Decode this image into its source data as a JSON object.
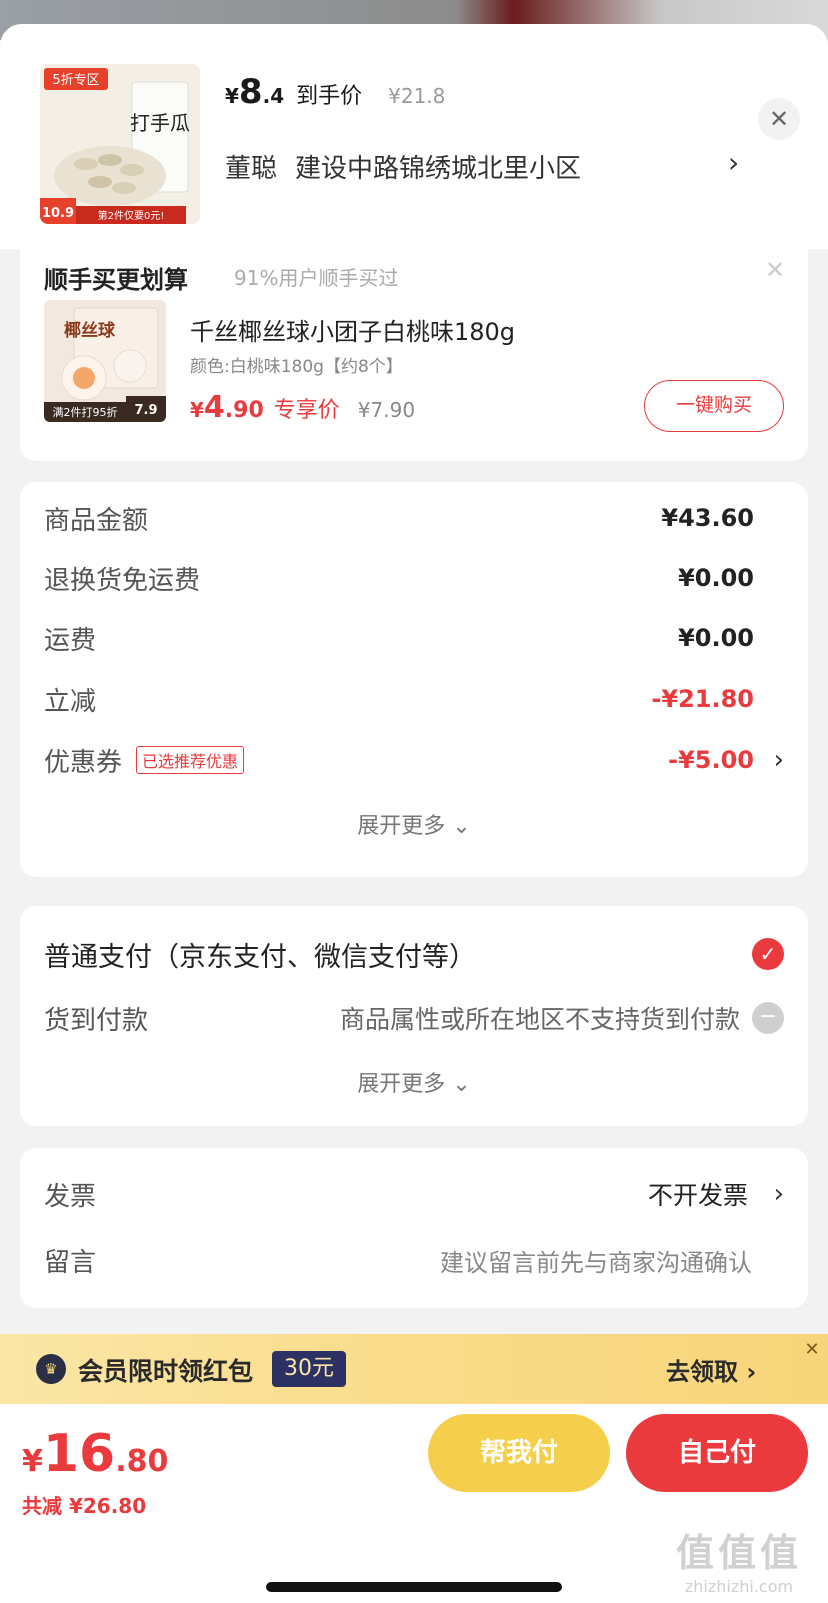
{
  "header": {
    "price_currency": "¥",
    "price_integer": "8",
    "price_decimal": ".4",
    "price_label": "到手价",
    "original_price": "¥21.8",
    "recipient": "董聪",
    "address": "建设中路锦绣城北里小区",
    "thumb_badge": "5折专区",
    "thumb_title": "打手瓜",
    "thumb_price": "10.9",
    "thumb_note": "第2件仅要0元!"
  },
  "recommendation": {
    "title": "顺手买更划算",
    "subtitle": "91%用户顺手买过",
    "product_name": "千丝椰丝球小团子白桃味180g",
    "variant": "颜色:白桃味180g【约8个】",
    "price_currency": "¥",
    "price_integer": "4",
    "price_decimal": ".90",
    "price_label": "专享价",
    "original_price": "¥7.90",
    "buy_label": "一键购买",
    "thumb_title": "椰丝球",
    "thumb_promo": "满2件打95折",
    "thumb_price": "7.9"
  },
  "amounts": {
    "rows": [
      {
        "label": "商品金额",
        "value": "¥43.60"
      },
      {
        "label": "退换货免运费",
        "value": "¥0.00"
      },
      {
        "label": "运费",
        "value": "¥0.00"
      },
      {
        "label": "立减",
        "value": "-¥21.80"
      },
      {
        "label": "优惠券",
        "value": "-¥5.00",
        "tag": "已选推荐优惠"
      }
    ],
    "expand_label": "展开更多"
  },
  "payment": {
    "option1": "普通支付（京东支付、微信支付等）",
    "option2": "货到付款",
    "option2_note": "商品属性或所在地区不支持货到付款",
    "expand_label": "展开更多"
  },
  "invoice": {
    "invoice_label": "发票",
    "invoice_value": "不开发票",
    "message_label": "留言",
    "message_placeholder": "建议留言前先与商家沟通确认"
  },
  "promo": {
    "text": "会员限时领红包",
    "badge": "30元",
    "cta": "去领取"
  },
  "checkout": {
    "currency": "¥",
    "total_integer": "16",
    "total_decimal": ".80",
    "saved": "共减 ¥26.80",
    "help_pay": "帮我付",
    "self_pay": "自己付"
  },
  "watermark": {
    "logo": "值值值",
    "url": "zhizhizhi.com"
  },
  "colors": {
    "accent_red": "#e93b3d",
    "help_yellow": "#f5cf4c",
    "promo_gold": "#f9dc8a",
    "badge_navy": "#2b3163"
  },
  "icons": [
    "close-icon",
    "chevron-right-icon",
    "check-icon",
    "disabled-icon",
    "crown-icon",
    "chevron-down-icon"
  ]
}
